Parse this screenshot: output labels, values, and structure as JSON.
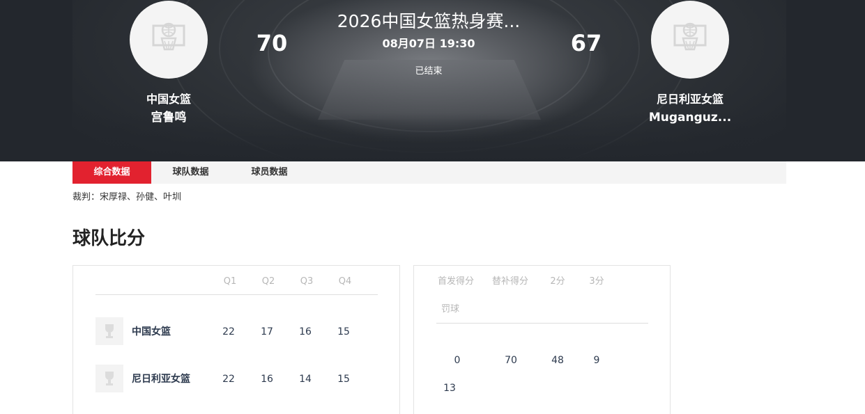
{
  "match": {
    "title": "2026中国女篮热身赛...",
    "time": "08月07日 19:30",
    "status": "已结束"
  },
  "home": {
    "name": "中国女篮",
    "coach": "宫鲁鸣",
    "score": "70",
    "logo_icon": "basketball-hoop-icon"
  },
  "away": {
    "name": "尼日利亚女篮",
    "coach": "Muganguz...",
    "score": "67",
    "logo_icon": "basketball-hoop-icon"
  },
  "tabs": [
    {
      "label": "综合数据",
      "active": true
    },
    {
      "label": "球队数据",
      "active": false
    },
    {
      "label": "球员数据",
      "active": false
    }
  ],
  "referees": "裁判：宋厚禄、孙健、叶圳",
  "section_title": "球队比分",
  "score_table": {
    "headers": [
      "Q1",
      "Q2",
      "Q3",
      "Q4"
    ],
    "rows": [
      {
        "team": "中国女篮",
        "values": [
          "22",
          "17",
          "16",
          "15"
        ]
      },
      {
        "team": "尼日利亚女篮",
        "values": [
          "22",
          "16",
          "14",
          "15"
        ]
      }
    ]
  },
  "stats_table": {
    "headers": [
      "首发得分",
      "替补得分",
      "2分",
      "3分",
      "罚球"
    ],
    "values": [
      "0",
      "70",
      "48",
      "9",
      "13"
    ]
  },
  "colors": {
    "accent": "#e2222f",
    "hero_bg": "#23272d",
    "text_dark": "#2d3a4e"
  }
}
